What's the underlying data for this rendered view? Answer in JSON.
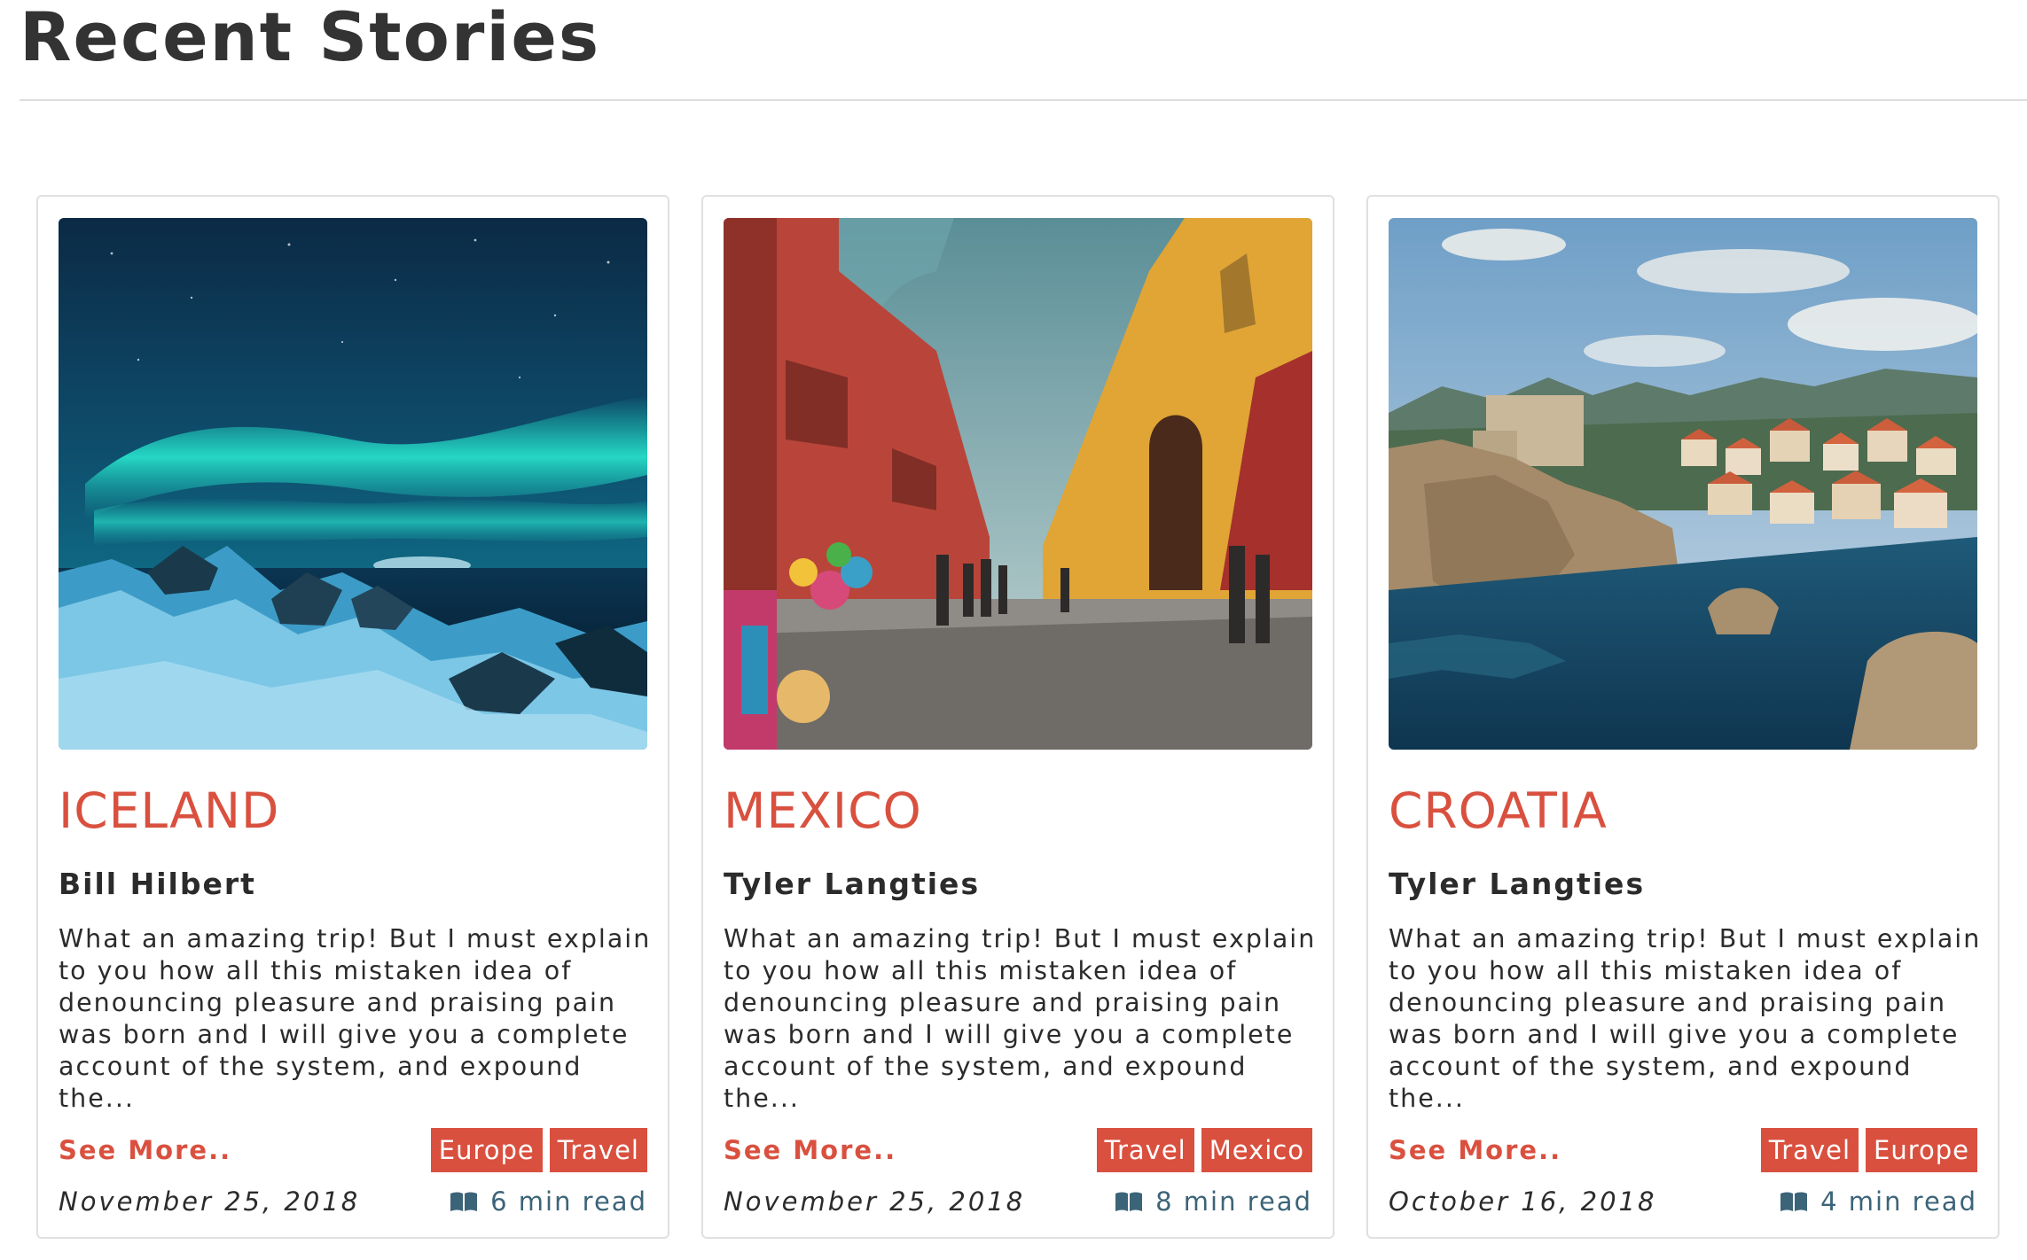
{
  "page": {
    "title": "Recent Stories"
  },
  "colors": {
    "accent": "#d9503f",
    "read_time": "#3c6478",
    "text": "#2b2b2b"
  },
  "cards": [
    {
      "title": "ICELAND",
      "author": "Bill Hilbert",
      "excerpt": "What an amazing trip! But I must explain to you how all this mistaken idea of denouncing pleasure and praising pain was born and I will give you a complete account of the system, and expound the...",
      "see_more": "See More..",
      "tags": [
        "Europe",
        "Travel"
      ],
      "date": "November 25, 2018",
      "read_time": "6 min read",
      "read_icon": "book-icon",
      "image": "aurora-over-icy-shore"
    },
    {
      "title": "MEXICO",
      "author": "Tyler Langties",
      "excerpt": "What an amazing trip! But I must explain to you how all this mistaken idea of denouncing pleasure and praising pain was born and I will give you a complete account of the system, and expound the...",
      "see_more": "See More..",
      "tags": [
        "Travel",
        "Mexico"
      ],
      "date": "November 25, 2018",
      "read_time": "8 min read",
      "read_icon": "book-icon",
      "image": "colorful-colonial-street"
    },
    {
      "title": "CROATIA",
      "author": "Tyler Langties",
      "excerpt": "What an amazing trip! But I must explain to you how all this mistaken idea of denouncing pleasure and praising pain was born and I will give you a complete account of the system, and expound the...",
      "see_more": "See More..",
      "tags": [
        "Travel",
        "Europe"
      ],
      "date": "October 16, 2018",
      "read_time": "4 min read",
      "read_icon": "book-icon",
      "image": "coastal-old-town-fortress"
    }
  ]
}
